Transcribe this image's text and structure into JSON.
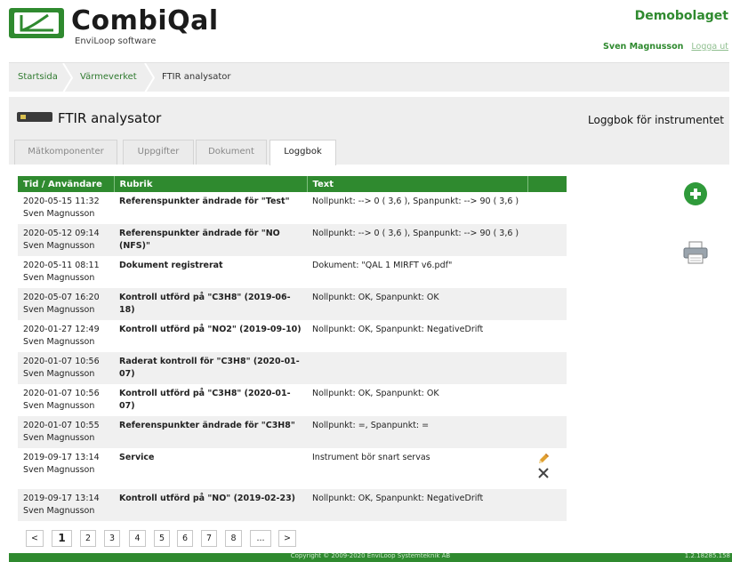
{
  "header": {
    "brand_name": "CombiQal",
    "brand_sub": "EnviLoop software",
    "org_name": "Demobolaget",
    "user_name": "Sven Magnusson",
    "logout_label": "Logga ut"
  },
  "breadcrumb": {
    "items": [
      "Startsida",
      "Värmeverket",
      "FTIR analysator"
    ]
  },
  "page": {
    "title": "FTIR analysator",
    "logbook_title": "Loggbok för instrumentet"
  },
  "tabs": [
    "Mätkomponenter",
    "Uppgifter",
    "Dokument",
    "Loggbok"
  ],
  "active_tab": "Loggbok",
  "table": {
    "headers": [
      "Tid / Användare",
      "Rubrik",
      "Text",
      ""
    ],
    "rows": [
      {
        "time": "2020-05-15 11:32",
        "user": "Sven Magnusson",
        "rubrik": "Referenspunkter ändrade för \"Test\"",
        "text": "Nollpunkt: --> 0 ( 3,6 ), Spanpunkt: --> 90 ( 3,6 )"
      },
      {
        "time": "2020-05-12 09:14",
        "user": "Sven Magnusson",
        "rubrik": "Referenspunkter ändrade för \"NO (NFS)\"",
        "text": "Nollpunkt: --> 0 ( 3,6 ), Spanpunkt: --> 90 ( 3,6 )"
      },
      {
        "time": "2020-05-11 08:11",
        "user": "Sven Magnusson",
        "rubrik": "Dokument registrerat",
        "text": "Dokument: \"QAL 1 MIRFT v6.pdf\""
      },
      {
        "time": "2020-05-07 16:20",
        "user": "Sven Magnusson",
        "rubrik": "Kontroll utförd på \"C3H8\" (2019-06-18)",
        "text": "Nollpunkt: OK, Spanpunkt: OK"
      },
      {
        "time": "2020-01-27 12:49",
        "user": "Sven Magnusson",
        "rubrik": "Kontroll utförd på \"NO2\" (2019-09-10)",
        "text": "Nollpunkt: OK, Spanpunkt: NegativeDrift"
      },
      {
        "time": "2020-01-07 10:56",
        "user": "Sven Magnusson",
        "rubrik": "Raderat kontroll för \"C3H8\" (2020-01-07)",
        "text": ""
      },
      {
        "time": "2020-01-07 10:56",
        "user": "Sven Magnusson",
        "rubrik": "Kontroll utförd på \"C3H8\" (2020-01-07)",
        "text": "Nollpunkt: OK, Spanpunkt: OK"
      },
      {
        "time": "2020-01-07 10:55",
        "user": "Sven Magnusson",
        "rubrik": "Referenspunkter ändrade för \"C3H8\"",
        "text": "Nollpunkt: =, Spanpunkt: ="
      },
      {
        "time": "2019-09-17 13:14",
        "user": "Sven Magnusson",
        "rubrik": "Service",
        "text": "Instrument bör snart servas",
        "editable": true
      },
      {
        "time": "2019-09-17 13:14",
        "user": "Sven Magnusson",
        "rubrik": "Kontroll utförd på \"NO\" (2019-02-23)",
        "text": "Nollpunkt: OK, Spanpunkt: NegativeDrift"
      }
    ]
  },
  "pagination": {
    "prev": "<",
    "pages": [
      "1",
      "2",
      "3",
      "4",
      "5",
      "6",
      "7",
      "8",
      "..."
    ],
    "current": "1",
    "next": ">"
  },
  "footer": {
    "copyright": "Copyright © 2009-2020 EnviLoop Systemteknik AB",
    "version": "1.2.18285.158"
  },
  "icons": {
    "add": "plus-circle-icon",
    "print": "printer-icon",
    "edit": "pencil-icon",
    "delete": "close-icon"
  },
  "colors": {
    "brand_green": "#2f8a2f",
    "add_green": "#2f9a3a"
  }
}
